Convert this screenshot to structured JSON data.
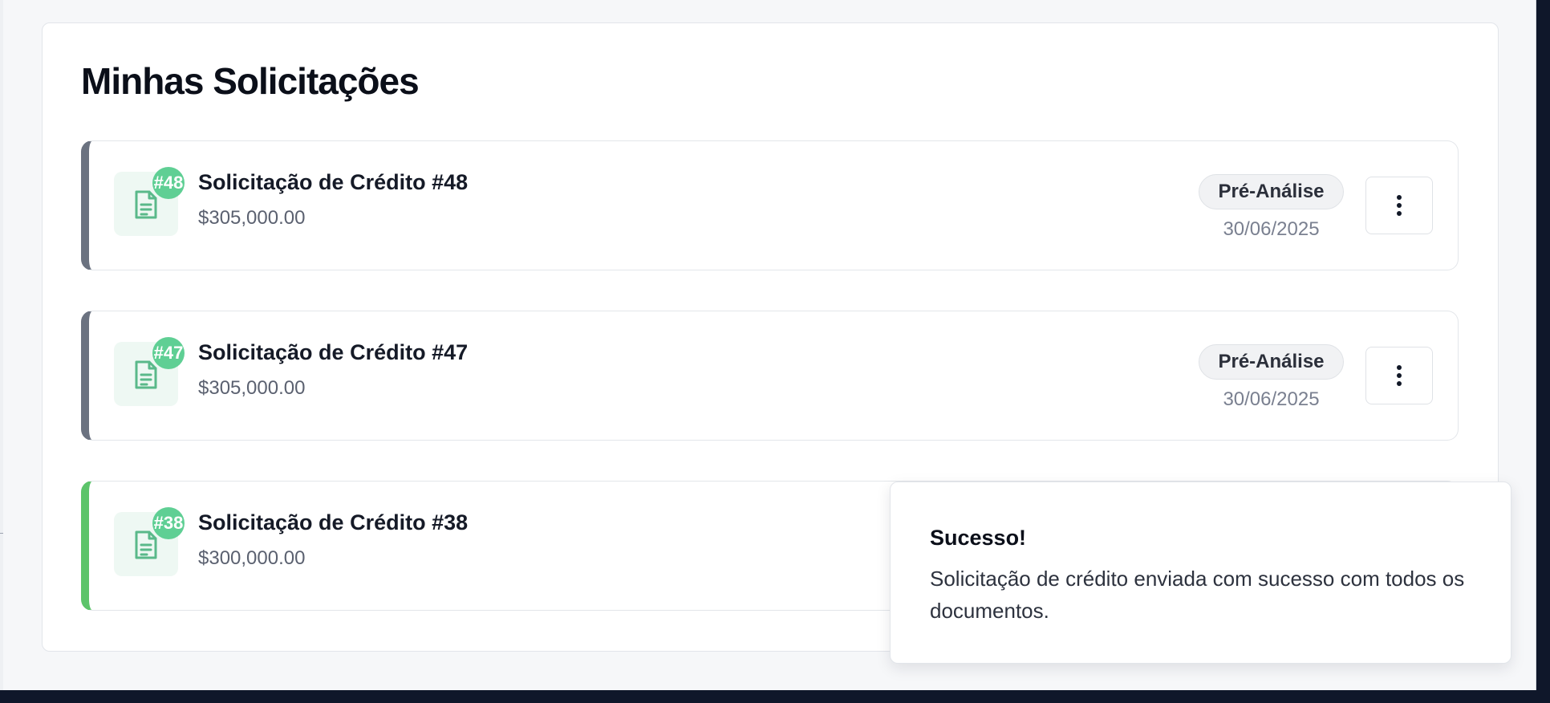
{
  "page": {
    "title": "Minhas Solicitações"
  },
  "requests": [
    {
      "badge": "#48",
      "title": "Solicitação de Crédito #48",
      "amount": "$305,000.00",
      "status": "Pré-Análise",
      "date": "30/06/2025",
      "accent": "#6b7280"
    },
    {
      "badge": "#47",
      "title": "Solicitação de Crédito #47",
      "amount": "$305,000.00",
      "status": "Pré-Análise",
      "date": "30/06/2025",
      "accent": "#6b7280"
    },
    {
      "badge": "#38",
      "title": "Solicitação de Crédito #38",
      "amount": "$300,000.00",
      "accent": "#5cc46a"
    }
  ],
  "toast": {
    "title": "Sucesso!",
    "message": "Solicitação de crédito enviada com sucesso com todos os documentos."
  },
  "icons": {
    "document": "file-text-icon",
    "menu": "more-vertical-icon"
  },
  "colors": {
    "badge_green": "#5fcf94",
    "doc_icon": "#5ab98a",
    "doc_bg": "#eef8f3",
    "page_bg": "#f6f7f9",
    "bottom_bar": "#0f172a"
  }
}
